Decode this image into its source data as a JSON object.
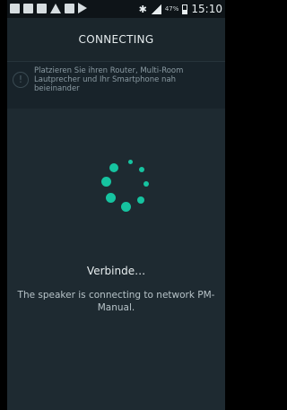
{
  "status_bar": {
    "left_icons": [
      "gallery-icon",
      "app-icon",
      "image-icon",
      "warning-icon",
      "message-icon",
      "play-icon"
    ],
    "bluetooth": "✱",
    "battery_percent": "47%",
    "time": "15:10"
  },
  "header": {
    "title": "CONNECTING"
  },
  "notice": {
    "icon_glyph": "!",
    "text": "Platzieren Sie ihren Router, Multi-Room Lautprecher und Ihr Smartphone nah beieinander"
  },
  "spinner": {
    "dot_count": 8,
    "color": "#16c3a0"
  },
  "status": {
    "title": "Verbinde…",
    "message": "The speaker is connecting to network PM-Manual."
  },
  "colors": {
    "background": "#1e2a31",
    "app_bar": "#1b262c",
    "notice_bg": "#18232a",
    "accent": "#16c3a0"
  }
}
